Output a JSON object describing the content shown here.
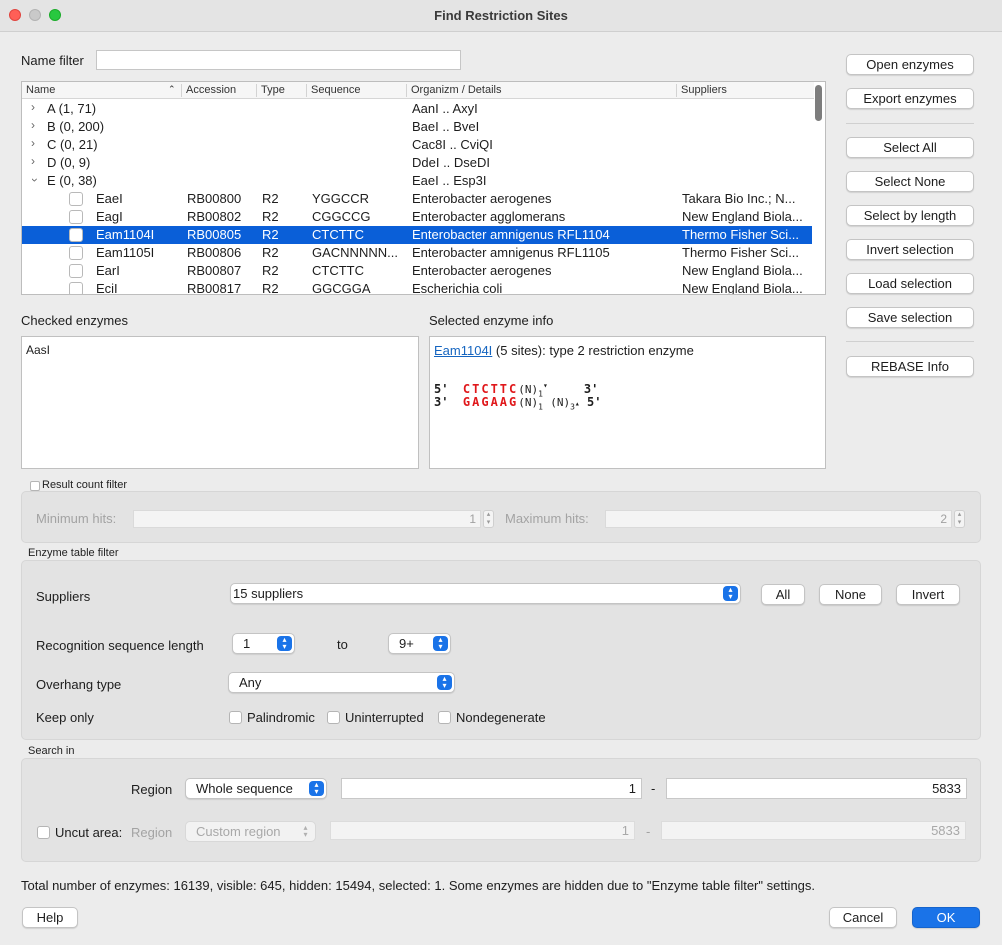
{
  "window": {
    "title": "Find Restriction Sites"
  },
  "name_filter": {
    "label": "Name filter",
    "value": ""
  },
  "table": {
    "headers": [
      "Name",
      "Accession",
      "Type",
      "Sequence",
      "Organizm / Details",
      "Suppliers"
    ],
    "rows": [
      {
        "kind": "group",
        "name": "A (1, 71)",
        "details": "AanI .. AxyI",
        "expanded": false
      },
      {
        "kind": "group",
        "name": "B (0, 200)",
        "details": "BaeI .. BveI",
        "expanded": false
      },
      {
        "kind": "group",
        "name": "C (0, 21)",
        "details": "Cac8I .. CviQI",
        "expanded": false
      },
      {
        "kind": "group",
        "name": "D (0, 9)",
        "details": "DdeI .. DseDI",
        "expanded": false
      },
      {
        "kind": "group",
        "name": "E (0, 38)",
        "details": "EaeI .. Esp3I",
        "expanded": true
      },
      {
        "kind": "enzyme",
        "name": "EaeI",
        "accession": "RB00800",
        "type": "R2",
        "sequence": "YGGCCR",
        "details": "Enterobacter aerogenes",
        "suppliers": "Takara Bio Inc.; N..."
      },
      {
        "kind": "enzyme",
        "name": "EagI",
        "accession": "RB00802",
        "type": "R2",
        "sequence": "CGGCCG",
        "details": "Enterobacter agglomerans",
        "suppliers": "New England Biola..."
      },
      {
        "kind": "enzyme",
        "name": "Eam1104I",
        "accession": "RB00805",
        "type": "R2",
        "sequence": "CTCTTC",
        "details": "Enterobacter amnigenus RFL1104",
        "suppliers": "Thermo Fisher Sci...",
        "selected": true
      },
      {
        "kind": "enzyme",
        "name": "Eam1105I",
        "accession": "RB00806",
        "type": "R2",
        "sequence": "GACNNNNN...",
        "details": "Enterobacter amnigenus RFL1105",
        "suppliers": "Thermo Fisher Sci..."
      },
      {
        "kind": "enzyme",
        "name": "EarI",
        "accession": "RB00807",
        "type": "R2",
        "sequence": "CTCTTC",
        "details": "Enterobacter aerogenes",
        "suppliers": "New England Biola..."
      },
      {
        "kind": "enzyme",
        "name": "EciI",
        "accession": "RB00817",
        "type": "R2",
        "sequence": "GGCGGA",
        "details": "Escherichia coli",
        "suppliers": "New England Biola..."
      }
    ]
  },
  "side_buttons": {
    "open": "Open enzymes",
    "export": "Export enzymes",
    "select_all": "Select All",
    "select_none": "Select None",
    "select_by_length": "Select by length",
    "invert_selection": "Invert selection",
    "load_selection": "Load selection",
    "save_selection": "Save selection",
    "rebase_info": "REBASE Info"
  },
  "checked_enzymes": {
    "label": "Checked enzymes",
    "items": [
      "AasI"
    ]
  },
  "selected_info": {
    "label": "Selected enzyme info",
    "enzyme_link": "Eam1104I",
    "summary": " (5 sites): type 2 restriction enzyme",
    "top_prefix": "5'",
    "top_seq": "CTCTTC",
    "top_suffix": "(N)",
    "top_sub": "1",
    "top_mark": "▾",
    "top_end": "3'",
    "bottom_prefix": "3'",
    "bottom_seq": "GAGAAG",
    "bottom_suffix": "(N)",
    "bottom_sub": "1",
    "bottom_suffix2": "(N)",
    "bottom_sub2": "3",
    "bottom_mark": "▴",
    "bottom_end": "5'"
  },
  "result_count_filter": {
    "label": "Result count filter",
    "checked": false,
    "min_label": "Minimum hits:",
    "min_value": "1",
    "max_label": "Maximum hits:",
    "max_value": "2"
  },
  "enzyme_table_filter": {
    "label": "Enzyme table filter",
    "suppliers_label": "Suppliers",
    "suppliers_value": "15 suppliers",
    "all_btn": "All",
    "none_btn": "None",
    "invert_btn": "Invert",
    "recog_label": "Recognition sequence length",
    "recog_from": "1",
    "to_label": "to",
    "recog_to": "9+",
    "overhang_label": "Overhang type",
    "overhang_value": "Any",
    "keep_only_label": "Keep only",
    "palindromic": "Palindromic",
    "uninterrupted": "Uninterrupted",
    "nondegenerate": "Nondegenerate"
  },
  "search_in": {
    "label": "Search in",
    "region_label": "Region",
    "region_value": "Whole sequence",
    "start": "1",
    "dash": "-",
    "end": "5833",
    "uncut_label": "Uncut area:",
    "uncut_region_label": "Region",
    "uncut_region_value": "Custom region",
    "uncut_start": "1",
    "uncut_end": "5833"
  },
  "status": "Total number of enzymes: 16139, visible: 645, hidden: 15494, selected: 1. Some enzymes are hidden due to \"Enzyme table filter\" settings.",
  "footer": {
    "help": "Help",
    "cancel": "Cancel",
    "ok": "OK"
  },
  "colors": {
    "accent": "#1a73e8",
    "selection": "#0a5fd8",
    "sequence_red": "#e0181b",
    "link": "#1565c0"
  }
}
